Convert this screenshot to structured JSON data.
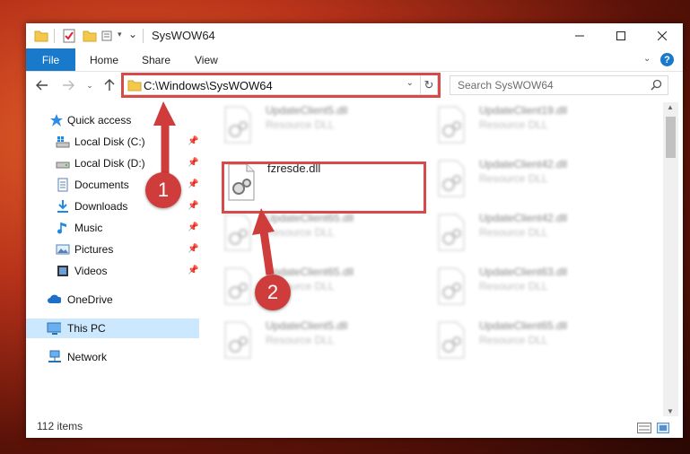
{
  "window": {
    "title": "SysWOW64"
  },
  "ribbon": {
    "tabs": [
      "File",
      "Home",
      "Share",
      "View"
    ],
    "help": "?"
  },
  "address": {
    "path": "C:\\Windows\\SysWOW64"
  },
  "search": {
    "placeholder": "Search SysWOW64"
  },
  "nav": {
    "quick_access": "Quick access",
    "items": [
      "Local Disk (C:)",
      "Local Disk (D:)",
      "Documents",
      "Downloads",
      "Music",
      "Pictures",
      "Videos"
    ],
    "onedrive": "OneDrive",
    "this_pc": "This PC",
    "network": "Network"
  },
  "files": {
    "highlighted": {
      "name": "fzresde.dll"
    },
    "blurred": [
      {
        "name": "UpdateClient5.dll",
        "type": "Resource DLL"
      },
      {
        "name": "UpdateClient19.dll",
        "type": "Resource DLL"
      },
      {
        "name": "UpdateClient42.dll",
        "type": "Resource DLL"
      },
      {
        "name": "UpdateClient65.dll",
        "type": "Resource DLL"
      },
      {
        "name": "UpdateClient42.dll",
        "type": "Resource DLL"
      },
      {
        "name": "UpdateClient65.dll",
        "type": "Resource DLL"
      },
      {
        "name": "UpdateClient63.dll",
        "type": "Resource DLL"
      },
      {
        "name": "UpdateClient5.dll",
        "type": "Resource DLL"
      },
      {
        "name": "UpdateClient65.dll",
        "type": "Resource DLL"
      }
    ]
  },
  "status": {
    "count": "112 items"
  },
  "annotations": {
    "step1": "1",
    "step2": "2"
  },
  "colors": {
    "accent": "#1979ca",
    "highlight": "#d64a4a",
    "selected": "#cce8ff"
  }
}
